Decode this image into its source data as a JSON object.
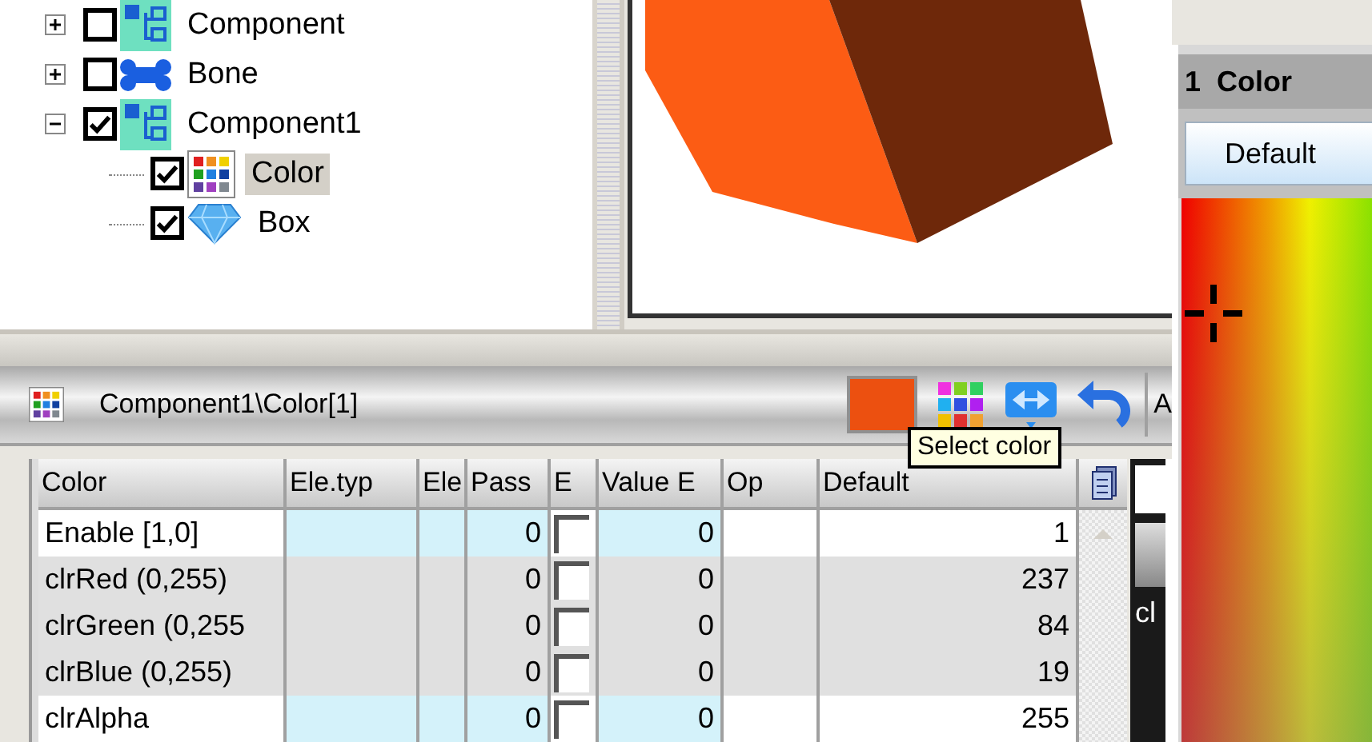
{
  "tree": [
    {
      "label": "Component",
      "kind": "component",
      "checked": false,
      "expanded": false,
      "selected": false
    },
    {
      "label": "Bone",
      "kind": "bone",
      "checked": false,
      "expanded": false,
      "selected": false
    },
    {
      "label": "Component1",
      "kind": "component",
      "checked": true,
      "expanded": true,
      "selected": false,
      "children": [
        {
          "label": "Color",
          "kind": "palette",
          "checked": true,
          "selected": true
        },
        {
          "label": "Box",
          "kind": "diamond",
          "checked": true,
          "selected": false
        }
      ]
    }
  ],
  "panel": {
    "path": "Component1\\Color[1]",
    "toolbar_text": "A",
    "tooltip": "Select color"
  },
  "table": {
    "columns": [
      "Color",
      "Ele.typ",
      "Ele",
      "Pass",
      "E",
      "Value E",
      "Op",
      "Default"
    ],
    "rows": [
      {
        "name": "Enable [1,0]",
        "pass": "0",
        "checked": false,
        "value": "0",
        "default": "1",
        "shaded": false
      },
      {
        "name": "clrRed (0,255)",
        "pass": "0",
        "checked": false,
        "value": "0",
        "default": "237",
        "shaded": true
      },
      {
        "name": "clrGreen (0,255",
        "pass": "0",
        "checked": false,
        "value": "0",
        "default": "84",
        "shaded": true
      },
      {
        "name": "clrBlue (0,255)",
        "pass": "0",
        "checked": false,
        "value": "0",
        "default": "19",
        "shaded": true
      },
      {
        "name": "clrAlpha",
        "pass": "0",
        "checked": false,
        "value": "0",
        "default": "255",
        "shaded": false
      }
    ]
  },
  "side_strip_text": "cl",
  "color_panel": {
    "title": "1  Color",
    "button": "Default"
  }
}
